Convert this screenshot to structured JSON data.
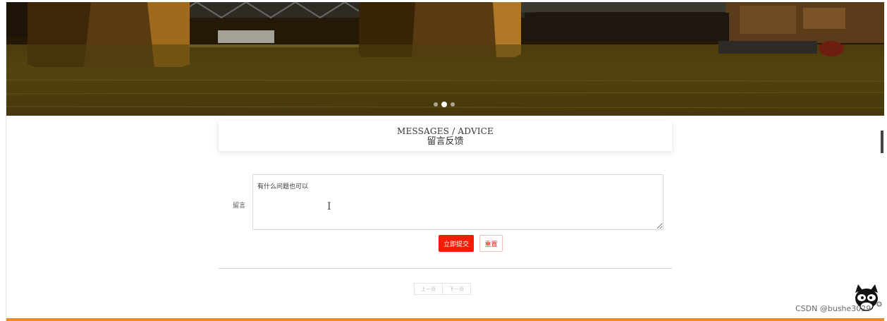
{
  "carousel": {
    "active_index": 1,
    "slide_count": 3
  },
  "section_title": {
    "english": "MESSAGES / ADVICE",
    "chinese": "留言反馈"
  },
  "form": {
    "message_label": "留言",
    "message_value": "有什么问题也可以",
    "submit_label": "立即提交",
    "reset_label": "重置"
  },
  "pagination": {
    "prev_label": "上一页",
    "next_label": "下一页"
  },
  "watermark": "CSDN @bushe3029",
  "colors": {
    "submit_bg": "#f31c04",
    "reset_text": "#e41b0d",
    "footer_bar": "#f08a24"
  }
}
